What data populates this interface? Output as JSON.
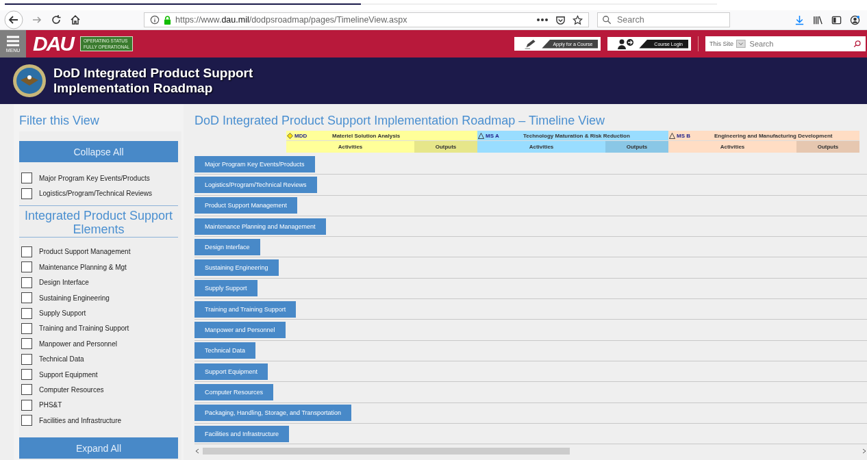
{
  "browser": {
    "url_host": "https://www.",
    "url_domain": "dau.mil",
    "url_path": "/dodpsroadmap/pages/TimelineView.aspx",
    "search": {
      "placeholder": "Search"
    }
  },
  "site_header": {
    "menu_label": "MENU",
    "logo": "DAU",
    "status": [
      "OPERATING STATUS",
      "FULLY OPERATIONAL"
    ],
    "buttons": [
      "Apply for a Course",
      "Course Login"
    ],
    "scope": "This Site",
    "search": {
      "placeholder": "Search"
    }
  },
  "banner": {
    "title": [
      "DoD Integrated Product Support",
      "Implementation Roadmap"
    ]
  },
  "sidebar": {
    "title": "Filter this View",
    "collapse": "Collapse All",
    "expand": "Expand All",
    "filters": [
      {
        "label": "Major Program Key Events/Products",
        "checked": false
      },
      {
        "label": "Logistics/Program/Technical Reviews",
        "checked": false
      }
    ],
    "section_title": "Integrated Product Support Elements",
    "elements": [
      {
        "label": "Product Support Management",
        "checked": false
      },
      {
        "label": "Maintenance Planning & Mgt",
        "checked": false
      },
      {
        "label": "Design Interface",
        "checked": false
      },
      {
        "label": "Sustaining Engineering",
        "checked": false
      },
      {
        "label": "Supply Support",
        "checked": false
      },
      {
        "label": "Training and Training Support",
        "checked": false
      },
      {
        "label": "Manpower and Personnel",
        "checked": false
      },
      {
        "label": "Technical Data",
        "checked": false
      },
      {
        "label": "Support Equipment",
        "checked": false
      },
      {
        "label": "Computer Resources",
        "checked": false
      },
      {
        "label": "PHS&T",
        "checked": false
      },
      {
        "label": "Facilities and Infrastructure",
        "checked": false
      }
    ]
  },
  "main": {
    "title": "DoD Integrated Product Support Implementation Roadmap – Timeline View",
    "phases": [
      {
        "milestone": "MDD",
        "kind": "diamond",
        "name": "Materiel Solution Analysis",
        "color": "#ffff99",
        "activities": "Activities",
        "outputs": "Outputs"
      },
      {
        "milestone": "MS A",
        "kind": "triangle",
        "name": "Technology Maturation & Risk Reduction",
        "color": "#99ddff",
        "activities": "Activities",
        "outputs": "Outputs"
      },
      {
        "milestone": "MS B",
        "kind": "triangle",
        "name": "Engineering and Manufacturing Development",
        "color": "#ffddc4",
        "activities": "Activities",
        "outputs": "Outputs"
      }
    ],
    "rows": [
      "Major Program Key Events/Products",
      "Logistics/Program/Technical Reviews",
      "Product Support Management",
      "Maintenance Planning and Management",
      "Design Interface",
      "Sustaining Engineering",
      "Supply Support",
      "Training and Training Support",
      "Manpower and Personnel",
      "Technical Data",
      "Support Equipment",
      "Computer Resources",
      "Packaging, Handling, Storage, and Transportation",
      "Facilities and Infrastructure"
    ]
  }
}
